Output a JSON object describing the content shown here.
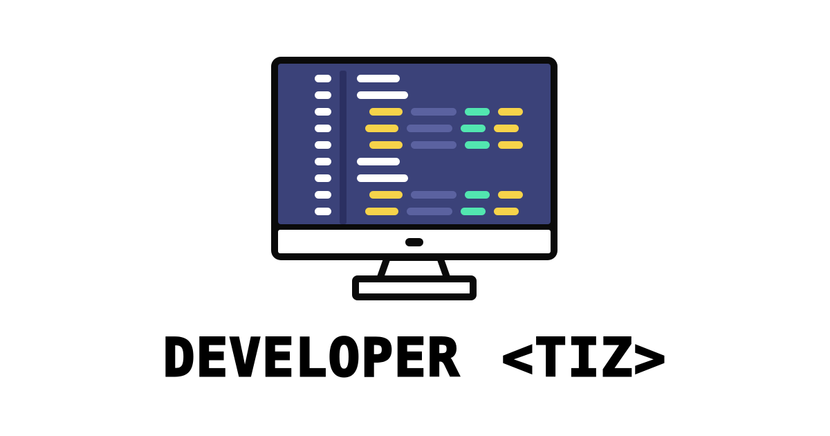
{
  "logo": {
    "icon": "desktop-monitor-code-icon",
    "colors": {
      "outline": "#0a0a0a",
      "screen": "#3b4279",
      "gutter": "#2b3062",
      "bezel": "#ffffff",
      "line_white": "#ffffff",
      "token_yellow": "#f6d34a",
      "token_muted": "#5b62a0",
      "token_green": "#52e6b0"
    }
  },
  "title": {
    "word": "DEVELOPER",
    "handle": "<TIZ>"
  }
}
